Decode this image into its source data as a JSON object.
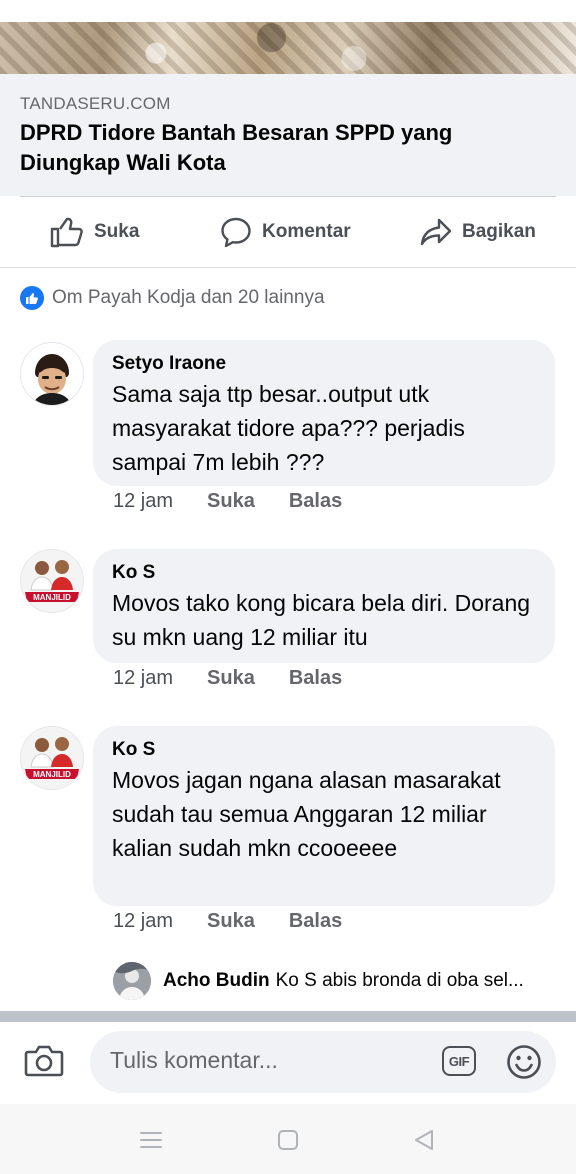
{
  "link_preview": {
    "domain": "TANDASERU.COM",
    "title": "DPRD Tidore Bantah Besaran SPPD yang Diungkap Wali Kota"
  },
  "actions": {
    "like": "Suka",
    "comment": "Komentar",
    "share": "Bagikan"
  },
  "reactions": {
    "summary": "Om Payah Kodja dan 20 lainnya"
  },
  "comments": [
    {
      "name": "Setyo Iraone",
      "text": "Sama saja ttp besar..output utk masyarakat tidore apa??? perjadis sampai 7m lebih ???",
      "time": "12 jam",
      "like": "Suka",
      "reply": "Balas"
    },
    {
      "name": "Ko S",
      "text": "Movos tako kong bicara bela diri. Dorang su mkn uang 12 miliar itu",
      "avatar_banner": "MANJILID",
      "time": "12 jam",
      "like": "Suka",
      "reply": "Balas"
    },
    {
      "name": "Ko S",
      "text": "Movos jagan ngana alasan masarakat sudah tau semua Anggaran 12 miliar kalian sudah mkn ccooeeee",
      "avatar_banner": "MANJILID",
      "time": "12 jam",
      "like": "Suka",
      "reply": "Balas"
    }
  ],
  "reply_preview": {
    "name": "Acho Budin",
    "text": "Ko S abis bronda di oba sel..."
  },
  "composer": {
    "placeholder": "Tulis komentar...",
    "gif_label": "GIF"
  },
  "icons": {
    "like": "thumbs-up-icon",
    "comment": "speech-bubble-icon",
    "share": "share-arrow-icon",
    "reaction": "like-reaction-icon",
    "camera": "camera-icon",
    "gif": "gif-icon",
    "emoji": "smiley-icon",
    "nav_menu": "menu-icon",
    "nav_home": "home-square-icon",
    "nav_back": "back-triangle-icon"
  },
  "colors": {
    "accent": "#1877f2",
    "bubble": "#f0f2f5",
    "secondary_text": "#65676b"
  }
}
